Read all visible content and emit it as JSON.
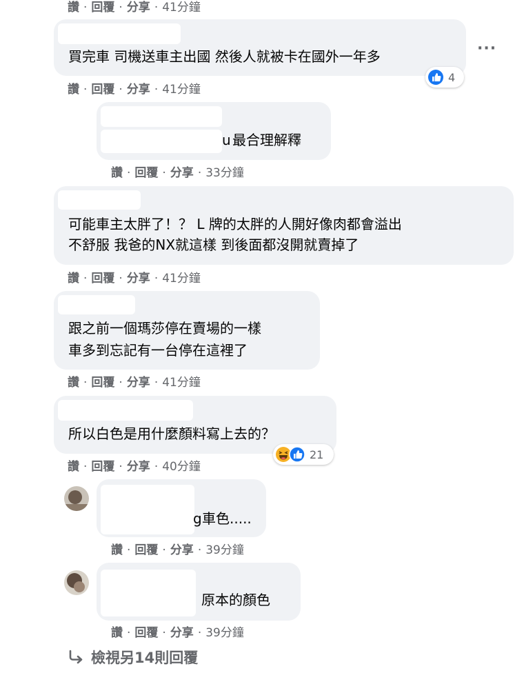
{
  "top_actions": {
    "read": "讚",
    "reply": "回覆",
    "share": "分享",
    "time": "41分鐘"
  },
  "actions": {
    "read": "讚",
    "reply": "回覆",
    "share": "分享"
  },
  "comments": [
    {
      "lines": [
        "買完車 司機送車主出國 然後人就被卡在國外一年多"
      ],
      "time": "41分鐘",
      "reaction_count": "4",
      "reactions": [
        "like-icon"
      ]
    },
    {
      "lines": [
        "最合理解釋"
      ],
      "prefix_fragment": "u",
      "time": "33分鐘"
    },
    {
      "lines": [
        "可能車主太胖了！？ L 牌的太胖的人開好像肉都會溢出",
        "不舒服 我爸的NX就這樣 到後面都沒開就賣掉了"
      ],
      "time": "41分鐘"
    },
    {
      "lines": [
        "跟之前一個瑪莎停在賣場的一樣",
        "車多到忘記有一台停在這裡了"
      ],
      "time": "41分鐘"
    },
    {
      "lines": [
        "所以白色是用什麼顏料寫上去的？"
      ],
      "time": "40分鐘",
      "reaction_count": "21",
      "reactions": [
        "haha-icon",
        "like-icon"
      ]
    },
    {
      "lines": [
        "車色....."
      ],
      "prefix_fragment": "g",
      "time": "39分鐘"
    },
    {
      "lines": [
        "原本的顏色"
      ],
      "time": "39分鐘"
    }
  ],
  "more_options": "···",
  "view_more": "檢視另14則回覆",
  "colors": {
    "bubble": "#f0f2f5",
    "meta": "#65676b",
    "like": "#1877f2",
    "haha": "#f7b125"
  }
}
